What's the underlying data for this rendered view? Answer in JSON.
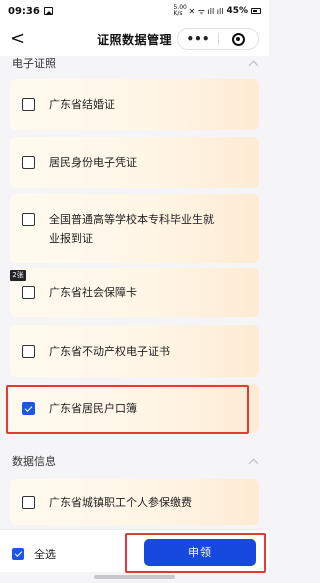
{
  "status_bar": {
    "time": "09:36",
    "speed": "5.00 K/s",
    "battery": "45%"
  },
  "nav": {
    "back_glyph": "<",
    "title": "证照数据管理",
    "more_glyph": "•••"
  },
  "sections": {
    "electronic": {
      "title": "电子证照"
    },
    "data_info": {
      "title": "数据信息"
    }
  },
  "cards": [
    {
      "label": "广东省结婚证",
      "checked": false
    },
    {
      "label": "居民身份电子凭证",
      "checked": false
    },
    {
      "label_line1": "全国普通高等学校本专科毕业生就",
      "label_line2": "业报到证",
      "checked": false
    },
    {
      "label": "广东省社会保障卡",
      "checked": false,
      "badge": "2张"
    },
    {
      "label": "广东省不动产权电子证书",
      "checked": false
    },
    {
      "label": "广东省居民户口簿",
      "checked": true
    },
    {
      "label": "广东省城镇职工个人参保缴费",
      "checked": false
    }
  ],
  "bottom": {
    "select_all_label": "全选",
    "select_all_checked": true,
    "apply_label": "申领"
  },
  "colors": {
    "accent": "#1749e0",
    "highlight_border": "#e53935",
    "card_bg": "#fff6e6"
  }
}
